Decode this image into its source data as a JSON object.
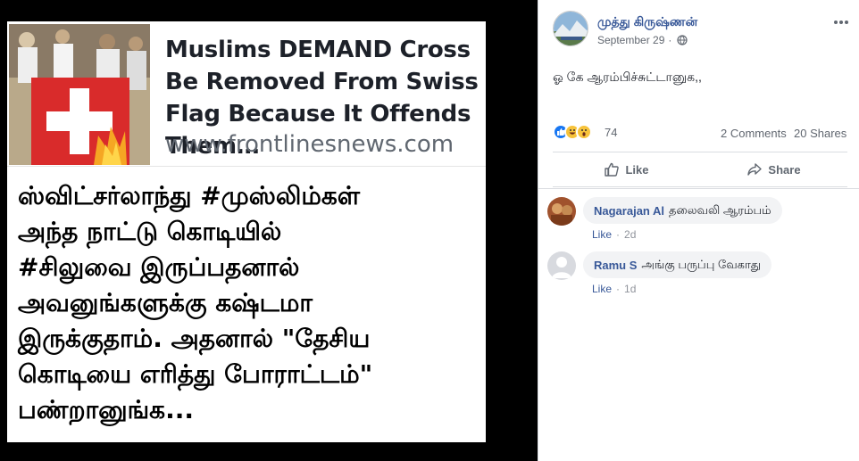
{
  "shared_card": {
    "link_preview": {
      "headline": "Muslims DEMAND Cross Be Removed From Swiss Flag Because It Offends Them…",
      "domain": "www.frontlinesnews.com"
    },
    "body_text": "ஸ்விட்சர்லாந்து #முஸ்லிம்கள்\nஅந்த நாட்டு கொடியில்\n#சிலுவை இருப்பதனால்\nஅவனுங்களுக்கு கஷ்டமா\nஇருக்குதாம். அதனால் \"தேசிய\nகொடியை எரித்து போராட்டம்\"\nபண்றானுங்க..."
  },
  "post": {
    "author": "முத்து கிருஷ்ணன்",
    "date": "September 29",
    "privacy_icon": "globe-icon",
    "text": "ஓ கே ஆரம்பிச்சுட்டானுக,,",
    "reactions": {
      "icons": [
        "like-icon",
        "haha-icon",
        "wow-icon"
      ],
      "count": "74"
    },
    "comments_count": "2 Comments",
    "shares_count": "20 Shares",
    "actions": {
      "like": "Like",
      "share": "Share"
    }
  },
  "comments": [
    {
      "name": "Nagarajan Al",
      "text": "தலைவலி ஆரம்பம்",
      "like_label": "Like",
      "time": "2d"
    },
    {
      "name": "Ramu S",
      "text": "அங்கு பருப்பு வேகாது",
      "like_label": "Like",
      "time": "1d"
    }
  ],
  "colors": {
    "link_blue": "#385898",
    "meta_gray": "#616770",
    "like_blue": "#1877f2",
    "bubble_bg": "#f2f3f5"
  }
}
